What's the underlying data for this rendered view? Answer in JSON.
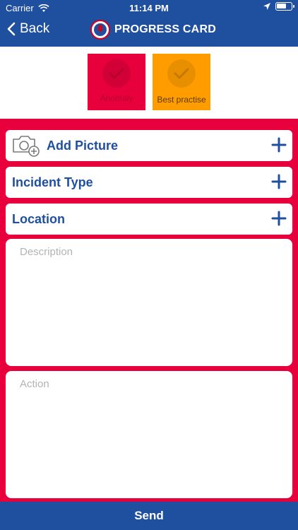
{
  "status_bar": {
    "carrier": "Carrier",
    "time": "11:14 PM"
  },
  "nav": {
    "back_label": "Back",
    "title": "PROGRESS CARD"
  },
  "categories": [
    {
      "label": "Anomaly",
      "color": "#e8003d"
    },
    {
      "label": "Best practise",
      "color": "#ff9d00"
    }
  ],
  "form": {
    "add_picture_label": "Add Picture",
    "incident_type_label": "Incident Type",
    "location_label": "Location",
    "description_placeholder": "Description",
    "action_placeholder": "Action"
  },
  "send_label": "Send",
  "colors": {
    "primary_blue": "#1f4f9f",
    "form_red": "#e8003d",
    "best_orange": "#ff9d00"
  }
}
